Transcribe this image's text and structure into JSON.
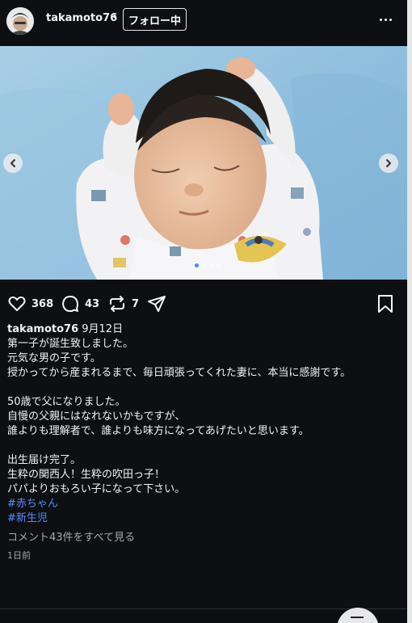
{
  "header": {
    "username": "takamoto76",
    "separator": "•",
    "follow_label": "フォロー中"
  },
  "carousel": {
    "total_slides": 4,
    "current_slide": 1
  },
  "actions": {
    "likes": "368",
    "comments": "43",
    "reposts": "7"
  },
  "caption": {
    "username": "takamoto76",
    "date": "9月12日",
    "lines_1": [
      "第一子が誕生致しました。",
      "元気な男の子です。",
      "授かってから産まれるまで、毎日頑張ってくれた妻に、本当に感謝です。"
    ],
    "lines_2": [
      "50歳で父になりました。",
      "自慢の父親にはなれないかもですが、",
      "誰よりも理解者で、誰よりも味方になってあげたいと思います。"
    ],
    "lines_3": [
      "出生届け完了。",
      "生粋の関西人！生粋の吹田っ子！",
      "パパよりおもろい子になって下さい。"
    ],
    "hashtags": [
      "#赤ちゃん",
      "#新生児"
    ]
  },
  "view_comments": "コメント43件をすべて見る",
  "time_ago": "1日前",
  "colors": {
    "background": "#0d0f13",
    "hashtag": "#5b8cff",
    "muted": "#a4a8b0",
    "dot_active": "#3d8cf2"
  }
}
